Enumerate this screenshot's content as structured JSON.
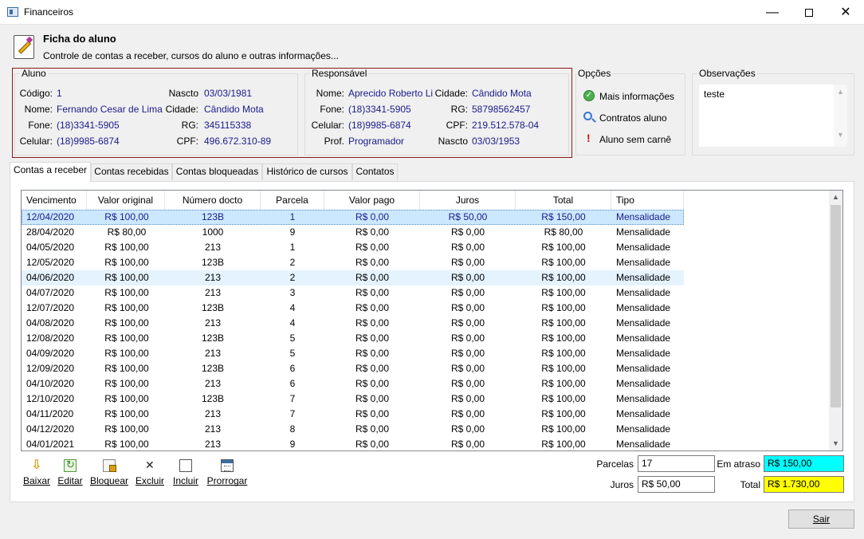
{
  "window": {
    "title": "Financeiros",
    "minimize": "—",
    "close": "✕"
  },
  "header": {
    "title": "Ficha do aluno",
    "subtitle": "Controle de contas a receber, cursos do aluno e outras informações..."
  },
  "aluno": {
    "legend": "Aluno",
    "codigo_label": "Código:",
    "codigo": "1",
    "nome_label": "Nome:",
    "nome": "Fernando Cesar de Lima",
    "fone_label": "Fone:",
    "fone": "(18)3341-5905",
    "celular_label": "Celular:",
    "celular": "(18)9985-6874",
    "nascto_label": "Nascto",
    "nascto": "03/03/1981",
    "cidade_label": "Cidade:",
    "cidade": "Cândido Mota",
    "rg_label": "RG:",
    "rg": "345115338",
    "cpf_label": "CPF:",
    "cpf": "496.672.310-89"
  },
  "responsavel": {
    "legend": "Responsável",
    "nome_label": "Nome:",
    "nome": "Aprecido Roberto Li",
    "fone_label": "Fone:",
    "fone": "(18)3341-5905",
    "celular_label": "Celular:",
    "celular": "(18)9985-6874",
    "prof_label": "Prof.",
    "prof": "Programador",
    "cidade_label": "Cidade:",
    "cidade": "Cândido Mota",
    "rg_label": "RG:",
    "rg": "58798562457",
    "cpf_label": "CPF:",
    "cpf": "219.512.578-04",
    "nascto_label": "Nascto",
    "nascto": "03/03/1953"
  },
  "opcoes": {
    "legend": "Opções",
    "mais_info": "Mais informações",
    "contratos": "Contratos aluno",
    "sem_carne": "Aluno sem carnê"
  },
  "observacoes": {
    "legend": "Observações",
    "text": "teste"
  },
  "tabs": [
    "Contas a receber",
    "Contas recebidas",
    "Contas bloqueadas",
    "Histórico de cursos",
    "Contatos"
  ],
  "grid": {
    "columns": [
      "Vencimento",
      "Valor original",
      "Número docto",
      "Parcela",
      "Valor pago",
      "Juros",
      "Total",
      "Tipo"
    ],
    "rows": [
      [
        "12/04/2020",
        "R$ 100,00",
        "123B",
        "1",
        "R$ 0,00",
        "R$ 50,00",
        "R$ 150,00",
        "Mensalidade"
      ],
      [
        "28/04/2020",
        "R$ 80,00",
        "1000",
        "9",
        "R$ 0,00",
        "R$ 0,00",
        "R$ 80,00",
        "Mensalidade"
      ],
      [
        "04/05/2020",
        "R$ 100,00",
        "213",
        "1",
        "R$ 0,00",
        "R$ 0,00",
        "R$ 100,00",
        "Mensalidade"
      ],
      [
        "12/05/2020",
        "R$ 100,00",
        "123B",
        "2",
        "R$ 0,00",
        "R$ 0,00",
        "R$ 100,00",
        "Mensalidade"
      ],
      [
        "04/06/2020",
        "R$ 100,00",
        "213",
        "2",
        "R$ 0,00",
        "R$ 0,00",
        "R$ 100,00",
        "Mensalidade"
      ],
      [
        "04/07/2020",
        "R$ 100,00",
        "213",
        "3",
        "R$ 0,00",
        "R$ 0,00",
        "R$ 100,00",
        "Mensalidade"
      ],
      [
        "12/07/2020",
        "R$ 100,00",
        "123B",
        "4",
        "R$ 0,00",
        "R$ 0,00",
        "R$ 100,00",
        "Mensalidade"
      ],
      [
        "04/08/2020",
        "R$ 100,00",
        "213",
        "4",
        "R$ 0,00",
        "R$ 0,00",
        "R$ 100,00",
        "Mensalidade"
      ],
      [
        "12/08/2020",
        "R$ 100,00",
        "123B",
        "5",
        "R$ 0,00",
        "R$ 0,00",
        "R$ 100,00",
        "Mensalidade"
      ],
      [
        "04/09/2020",
        "R$ 100,00",
        "213",
        "5",
        "R$ 0,00",
        "R$ 0,00",
        "R$ 100,00",
        "Mensalidade"
      ],
      [
        "12/09/2020",
        "R$ 100,00",
        "123B",
        "6",
        "R$ 0,00",
        "R$ 0,00",
        "R$ 100,00",
        "Mensalidade"
      ],
      [
        "04/10/2020",
        "R$ 100,00",
        "213",
        "6",
        "R$ 0,00",
        "R$ 0,00",
        "R$ 100,00",
        "Mensalidade"
      ],
      [
        "12/10/2020",
        "R$ 100,00",
        "123B",
        "7",
        "R$ 0,00",
        "R$ 0,00",
        "R$ 100,00",
        "Mensalidade"
      ],
      [
        "04/11/2020",
        "R$ 100,00",
        "213",
        "7",
        "R$ 0,00",
        "R$ 0,00",
        "R$ 100,00",
        "Mensalidade"
      ],
      [
        "04/12/2020",
        "R$ 100,00",
        "213",
        "8",
        "R$ 0,00",
        "R$ 0,00",
        "R$ 100,00",
        "Mensalidade"
      ],
      [
        "04/01/2021",
        "R$ 100,00",
        "213",
        "9",
        "R$ 0,00",
        "R$ 0,00",
        "R$ 100,00",
        "Mensalidade"
      ]
    ]
  },
  "toolbar": {
    "baixar": "Baixar",
    "editar": "Editar",
    "bloquear": "Bloquear",
    "excluir": "Excluir",
    "incluir": "Incluir",
    "prorrogar": "Prorrogar"
  },
  "summary": {
    "parcelas_label": "Parcelas",
    "parcelas": "17",
    "juros_label": "Juros",
    "juros": "R$ 50,00",
    "em_atraso_label": "Em atraso",
    "em_atraso": "R$ 150,00",
    "total_label": "Total",
    "total": "R$ 1.730,00"
  },
  "buttons": {
    "sair": "Sair"
  }
}
